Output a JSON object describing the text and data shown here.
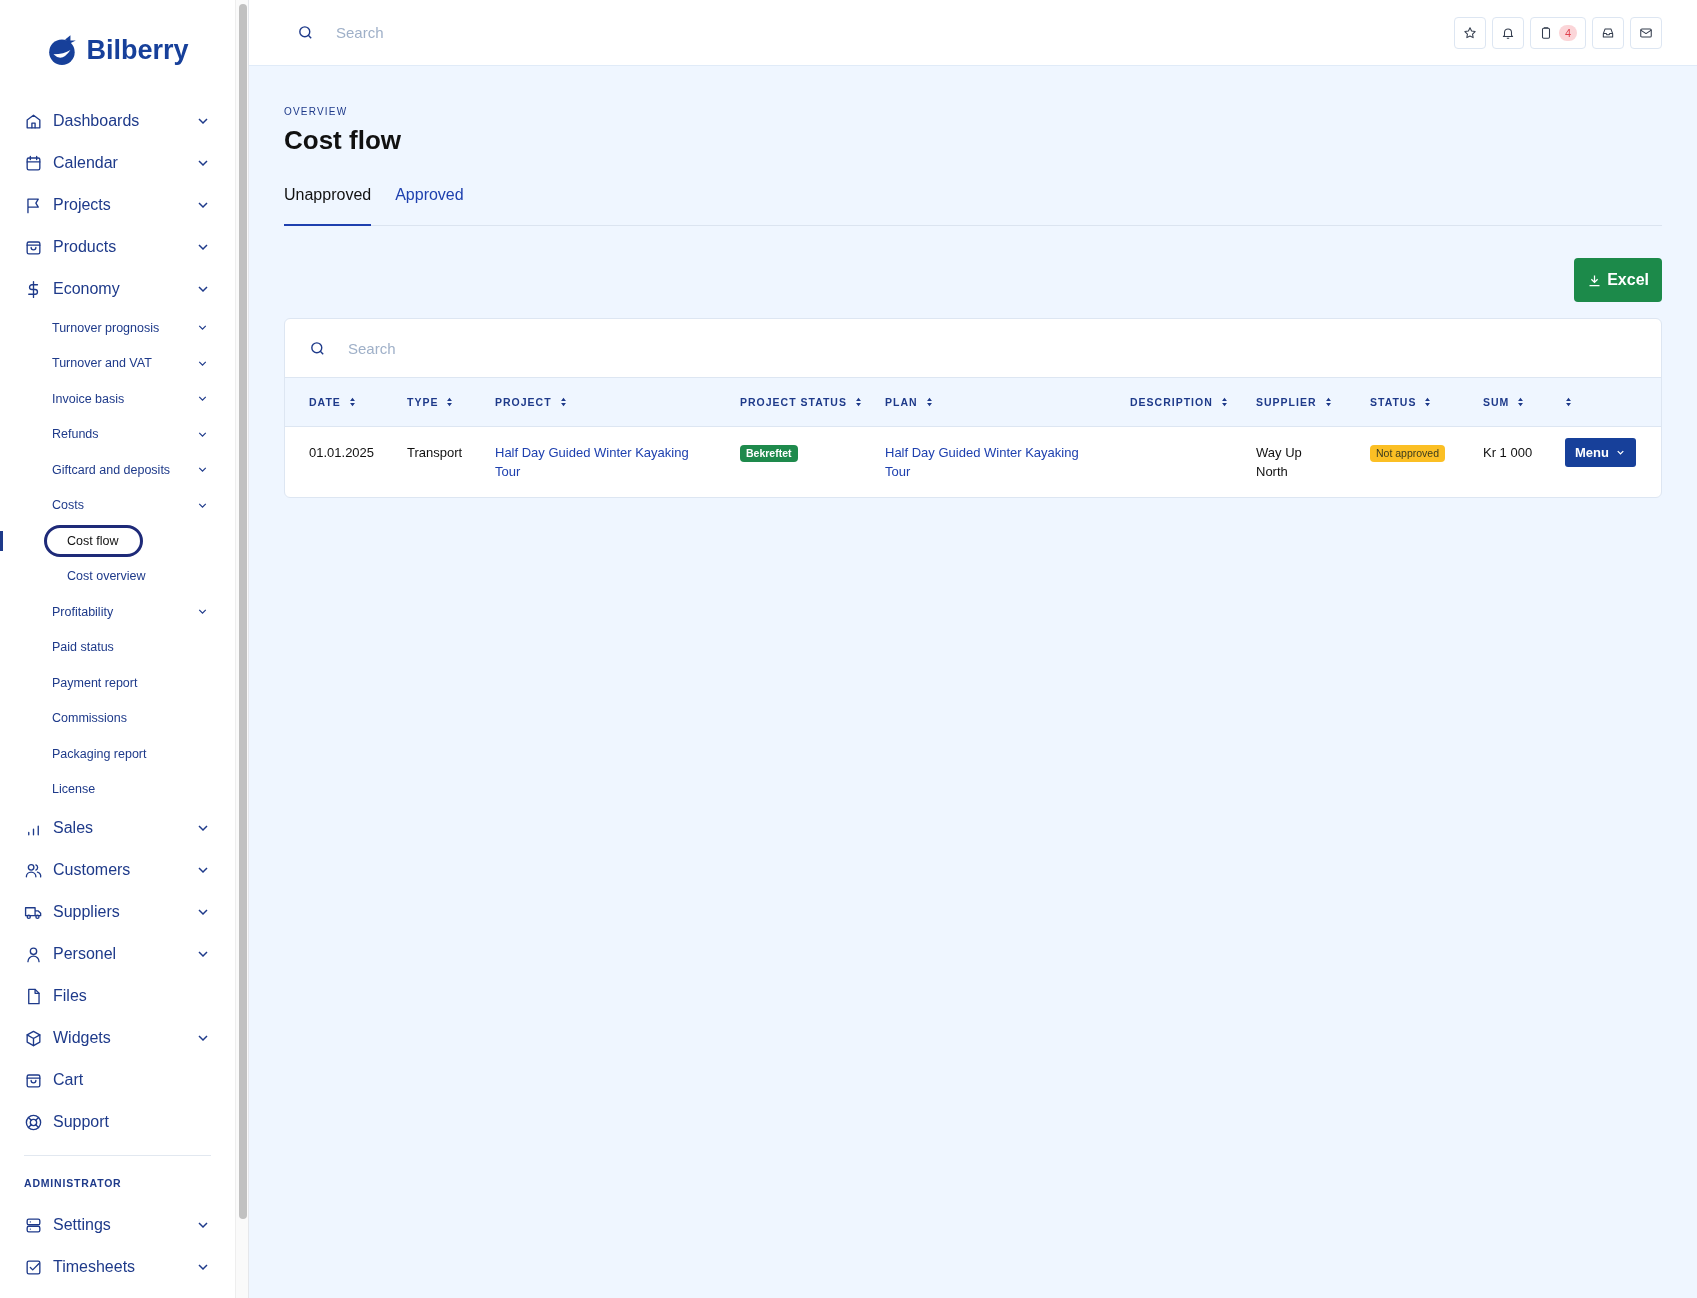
{
  "sidebar": {
    "logo": "Bilberry",
    "items": [
      {
        "label": "Dashboards",
        "expandable": true,
        "selected": false
      },
      {
        "label": "Calendar",
        "expandable": true,
        "selected": false
      },
      {
        "label": "Projects",
        "expandable": true,
        "selected": false
      },
      {
        "label": "Products",
        "expandable": true,
        "selected": false
      },
      {
        "label": "Economy",
        "expandable": true,
        "selected": false,
        "children": [
          {
            "label": "Turnover prognosis",
            "expandable": true,
            "selected": false
          },
          {
            "label": "Turnover and VAT",
            "expandable": true,
            "selected": false
          },
          {
            "label": "Invoice basis",
            "expandable": true,
            "selected": false
          },
          {
            "label": "Refunds",
            "expandable": true,
            "selected": false
          },
          {
            "label": "Giftcard and deposits",
            "expandable": true,
            "selected": false
          },
          {
            "label": "Costs",
            "expandable": true,
            "selected": false,
            "children": [
              {
                "label": "Cost flow",
                "selected": true
              },
              {
                "label": "Cost overview",
                "selected": false
              }
            ]
          },
          {
            "label": "Profitability",
            "expandable": true,
            "selected": false
          },
          {
            "label": "Paid status",
            "expandable": false,
            "selected": false
          },
          {
            "label": "Payment report",
            "expandable": false,
            "selected": false
          },
          {
            "label": "Commissions",
            "expandable": false,
            "selected": false
          },
          {
            "label": "Packaging report",
            "expandable": false,
            "selected": false
          },
          {
            "label": "License",
            "expandable": false,
            "selected": false
          }
        ]
      },
      {
        "label": "Sales",
        "expandable": true,
        "selected": false
      },
      {
        "label": "Customers",
        "expandable": true,
        "selected": false
      },
      {
        "label": "Suppliers",
        "expandable": true,
        "selected": false
      },
      {
        "label": "Personel",
        "expandable": true,
        "selected": false
      },
      {
        "label": "Files",
        "expandable": false,
        "selected": false
      },
      {
        "label": "Widgets",
        "expandable": true,
        "selected": false
      },
      {
        "label": "Cart",
        "expandable": false,
        "selected": false
      },
      {
        "label": "Support",
        "expandable": false,
        "selected": false
      }
    ],
    "section_label": "ADMINISTRATOR",
    "admin_items": [
      {
        "label": "Settings",
        "expandable": true,
        "selected": false
      },
      {
        "label": "Timesheets",
        "expandable": true,
        "selected": false
      }
    ]
  },
  "topbar": {
    "search": {
      "placeholder": "Search"
    },
    "notification_count": "4"
  },
  "page": {
    "eyebrow": "OVERVIEW",
    "title": "Cost flow",
    "tabs": [
      {
        "label": "Unapproved",
        "selected": true
      },
      {
        "label": "Approved",
        "selected": false
      }
    ],
    "export_button": "Excel"
  },
  "table": {
    "search": {
      "placeholder": "Search"
    },
    "columns": [
      "DATE",
      "TYPE",
      "PROJECT",
      "PROJECT STATUS",
      "PLAN",
      "DESCRIPTION",
      "SUPPLIER",
      "STATUS",
      "SUM",
      ""
    ],
    "rows": [
      {
        "date": "01.01.2025",
        "type": "Transport",
        "project": "Half Day Guided Winter Kayaking Tour",
        "project_status": {
          "text": "Bekreftet",
          "color": "#1e8a4c"
        },
        "plan": "Half Day Guided Winter Kayaking Tour",
        "supplier": "Way Up North",
        "status": {
          "text": "Not approved",
          "color": "#fbbf24"
        },
        "sum": "Kr 1 000",
        "action": "Menu"
      }
    ]
  }
}
